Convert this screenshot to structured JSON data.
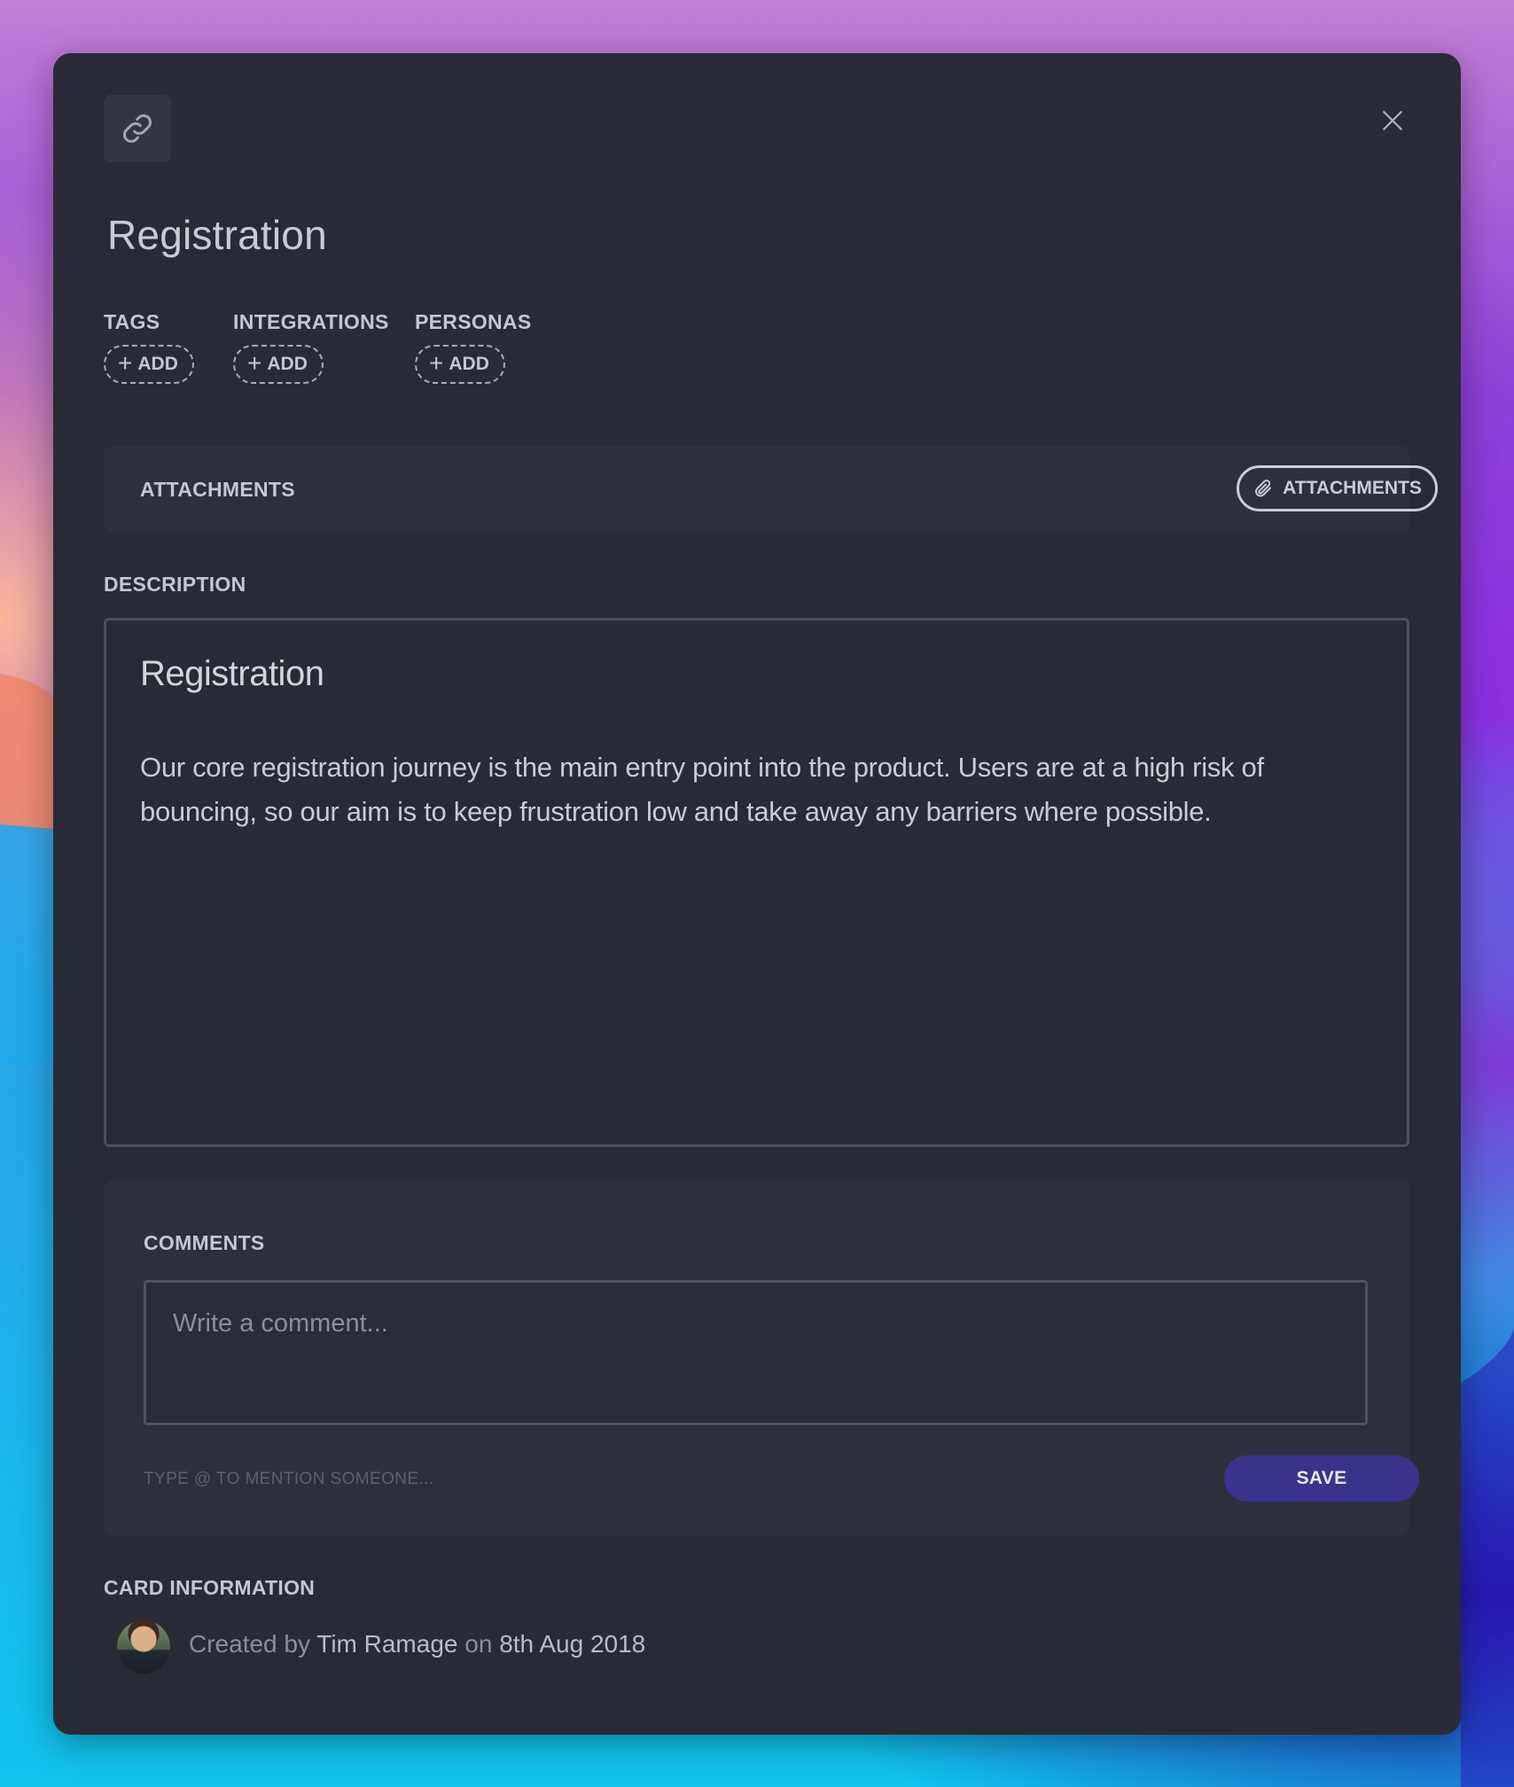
{
  "card": {
    "title": "Registration"
  },
  "meta": {
    "tags_label": "TAGS",
    "integrations_label": "INTEGRATIONS",
    "personas_label": "PERSONAS",
    "add_label": "ADD"
  },
  "attachments": {
    "label": "ATTACHMENTS",
    "button_label": "ATTACHMENTS"
  },
  "description": {
    "label": "DESCRIPTION",
    "heading": "Registration",
    "body": "Our core registration journey is the main entry point into the product. Users are at a high risk of bouncing, so our aim is to keep frustration low and take away any barriers where possible."
  },
  "comments": {
    "label": "COMMENTS",
    "placeholder": "Write a comment...",
    "mention_hint": "TYPE @ TO MENTION SOMEONE...",
    "save_label": "SAVE"
  },
  "card_info": {
    "label": "CARD INFORMATION",
    "created_prefix": "Created by",
    "author": "Tim Ramage",
    "on_word": "on",
    "date": "8th Aug 2018"
  },
  "icons": {
    "link": "link-icon",
    "close": "close-icon",
    "paperclip": "paperclip-icon",
    "plus": "plus-icon"
  },
  "colors": {
    "modal_bg": "#282b36",
    "panel_bg": "#2d303c",
    "save_button": "#3a338c"
  }
}
